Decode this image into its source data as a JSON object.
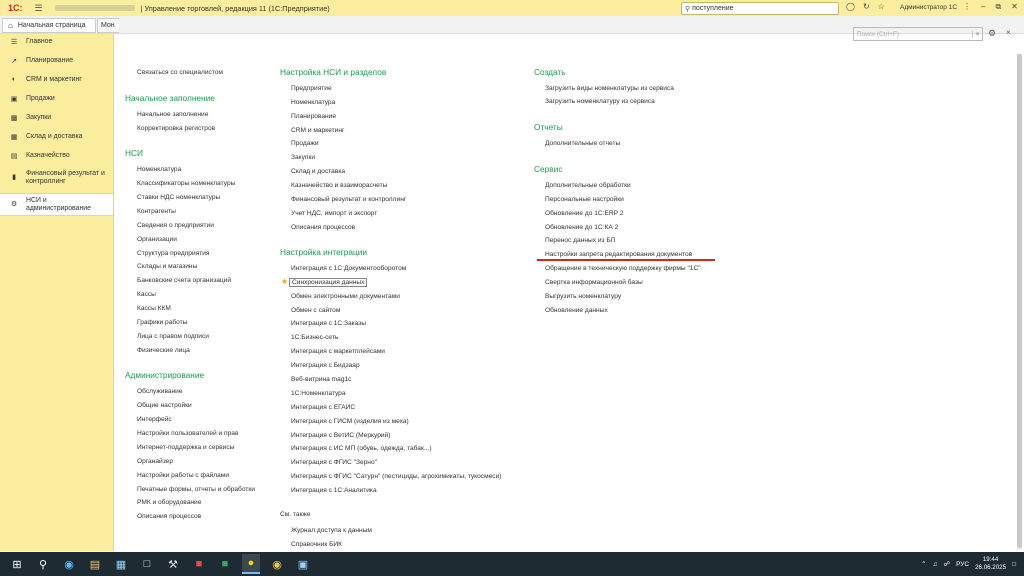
{
  "titlebar": {
    "logo": "1С:",
    "menu_icon": "☰",
    "app_title": "| Управление торговлей, редакция 11  (1С:Предприятие)",
    "search_value": "поступление",
    "user": "Администратор 1С"
  },
  "tabs": {
    "home": "Начальная страница",
    "mon": "Мон"
  },
  "sidebar": {
    "items": [
      {
        "label": "Главное",
        "icon": "menu-icon"
      },
      {
        "label": "Планирование",
        "icon": "chart-icon"
      },
      {
        "label": "CRM и маркетинг",
        "icon": "crm-icon"
      },
      {
        "label": "Продажи",
        "icon": "bag-icon"
      },
      {
        "label": "Закупки",
        "icon": "cart-icon"
      },
      {
        "label": "Склад и доставка",
        "icon": "warehouse-icon"
      },
      {
        "label": "Казначейство",
        "icon": "money-icon"
      },
      {
        "label": "Финансовый результат и контроллинг",
        "icon": "bar-chart-icon"
      },
      {
        "label": "НСИ и администрирование",
        "icon": "gear-icon"
      }
    ]
  },
  "content": {
    "search_placeholder": "Поиск (Ctrl+F)",
    "col1": {
      "top_link": "Связаться со специалистом",
      "s1_title": "Начальное заполнение",
      "s1_items": [
        "Начальное заполнение",
        "Корректировка регистров"
      ],
      "s2_title": "НСИ",
      "s2_items": [
        "Номенклатура",
        "Классификаторы номенклатуры",
        "Ставки НДС номенклатуры",
        "Контрагенты",
        "Сведения о предприятии",
        "Организации",
        "Структура предприятия",
        "Склады и магазины",
        "Банковские счета организаций",
        "Кассы",
        "Кассы ККМ",
        "Графики работы",
        "Лица с правом подписи",
        "Физические лица"
      ],
      "s3_title": "Администрирование",
      "s3_items": [
        "Обслуживание",
        "Общие настройки",
        "Интерфейс",
        "Настройки пользователей и прав",
        "Интернет-поддержка и сервисы",
        "Органайзер",
        "Настройки работы с файлами",
        "Печатные формы, отчеты и обработки",
        "РМК и оборудование",
        "Описания процессов"
      ]
    },
    "col2": {
      "s1_title": "Настройка НСИ и разделов",
      "s1_items": [
        "Предприятие",
        "Номенклатура",
        "Планирование",
        "CRM и маркетинг",
        "Продажи",
        "Закупки",
        "Склад и доставка",
        "Казначейство и взаиморасчеты",
        "Финансовый результат и контроллинг",
        "Учет НДС, импорт и экспорт",
        "Описания процессов"
      ],
      "s2_title": "Настройка интеграции",
      "s2_items": [
        "Интеграция с 1С:Документооборотом",
        "Синхронизация данных",
        "Обмен электронными документами",
        "Обмен с сайтом",
        "Интеграция с 1С:Заказы",
        "1С:Бизнес-сеть",
        "Интеграция с маркетплейсами",
        "Интеграция с Бидзаар",
        "Веб-витрина mag1c",
        "1С:Номенклатура",
        "Интеграция с ЕГАИС",
        "Интеграция с ГИСМ (изделия из меха)",
        "Интеграция с ВетИС (Меркурий)",
        "Интеграция с ИС МП (обувь, одежда, табак...)",
        "Интеграция с ФГИС \"Зерно\"",
        "Интеграция с ФГИС \"Сатурн\" (пестициды, агрохимикаты, тукосмеси)",
        "Интеграция с 1С:Аналитика"
      ],
      "s3_title": "См. также",
      "s3_items": [
        "Журнал доступа к данным",
        "Справочник БИК"
      ]
    },
    "col3": {
      "s1_title": "Создать",
      "s1_items": [
        "Загрузить виды номенклатуры из сервиса",
        "Загрузить номенклатуру из сервиса"
      ],
      "s2_title": "Отчеты",
      "s2_items": [
        "Дополнительные отчеты"
      ],
      "s3_title": "Сервис",
      "s3_items": [
        "Дополнительные обработки",
        "Персональные настройки",
        "Обновление до 1С:ERP 2",
        "Обновление до 1С:КА 2",
        "Перенос данных из БП",
        "Настройки запрета редактирования документов",
        "Обращение в техническую поддержку фирмы \"1С\"",
        "Свертка информационной базы",
        "Выгрузить номенклатуру",
        "Обновление данных"
      ]
    }
  },
  "taskbar": {
    "lang": "РУС",
    "time": "19:44",
    "date": "26.06.2025"
  }
}
